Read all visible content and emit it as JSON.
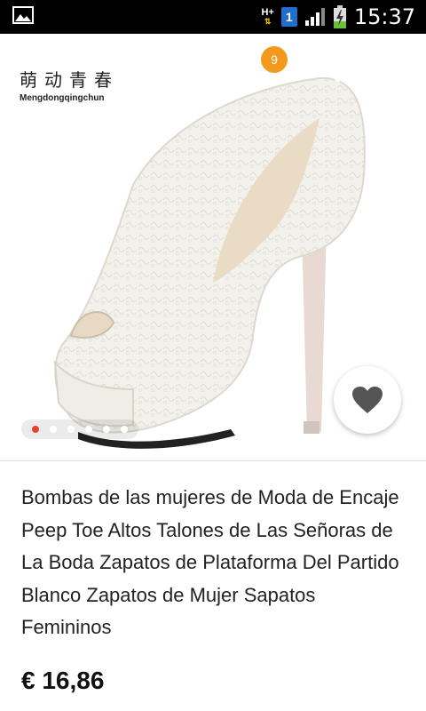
{
  "status_bar": {
    "network": "H+",
    "sim": "1",
    "time": "15:37"
  },
  "header": {
    "brand_cn": "萌动青春",
    "brand_latin": "Mengdongqingchun",
    "cart_count": "9"
  },
  "gallery": {
    "image_count": 6,
    "active_index": 0
  },
  "product": {
    "title": "Bombas de las mujeres de Moda de Encaje Peep Toe Altos Talones de Las Señoras de La Boda Zapatos de Plataforma Del Partido Blanco Zapatos de Mujer Sapatos Femininos",
    "price": "€ 16,86"
  },
  "colors": {
    "badge": "#f39a1c",
    "active_dot": "#e0452c"
  }
}
